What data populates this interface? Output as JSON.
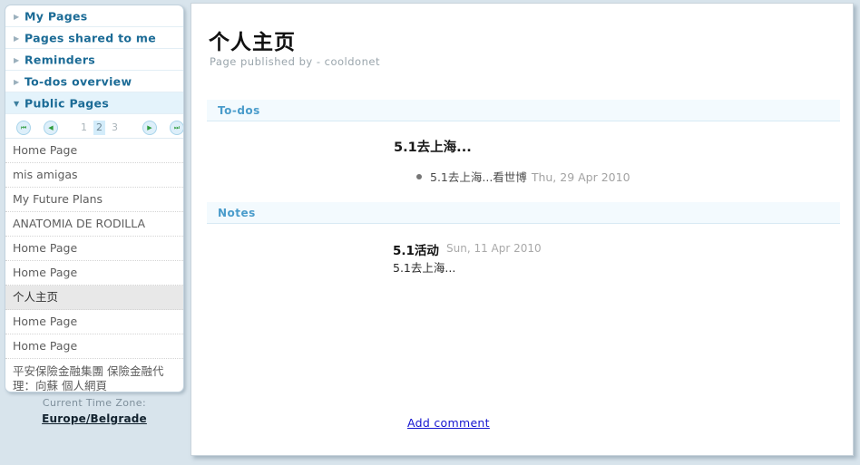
{
  "sidebar": {
    "nav": [
      {
        "label": "My Pages",
        "icon": "triangle-right-icon",
        "expanded": false
      },
      {
        "label": "Pages shared to me",
        "icon": "triangle-right-icon",
        "expanded": false
      },
      {
        "label": "Reminders",
        "icon": "triangle-right-icon",
        "expanded": false
      },
      {
        "label": "To-dos overview",
        "icon": "triangle-right-icon",
        "expanded": false
      },
      {
        "label": "Public Pages",
        "icon": "triangle-down-icon",
        "expanded": true
      }
    ],
    "pager": {
      "first_icon": "⏮",
      "prev_icon": "◀",
      "next_icon": "▶",
      "last_icon": "⏭",
      "pages": [
        "1",
        "2",
        "3"
      ],
      "current": "2"
    },
    "pages": [
      {
        "label": "Home Page",
        "selected": false
      },
      {
        "label": "mis amigas",
        "selected": false
      },
      {
        "label": "My Future Plans",
        "selected": false
      },
      {
        "label": "ANATOMIA DE RODILLA",
        "selected": false
      },
      {
        "label": "Home Page",
        "selected": false
      },
      {
        "label": "Home Page",
        "selected": false
      },
      {
        "label": "个人主页",
        "selected": true
      },
      {
        "label": "Home Page",
        "selected": false
      },
      {
        "label": "Home Page",
        "selected": false
      },
      {
        "label": "平安保險金融集團 保險金融代理：向蘇 個人網頁",
        "selected": false
      }
    ],
    "timezone": {
      "label": "Current Time Zone:",
      "value": "Europe/Belgrade"
    }
  },
  "main": {
    "title": "个人主页",
    "subtitle": "Page published by - cooldonet",
    "todos": {
      "header": "To-dos",
      "group_title": "5.1去上海...",
      "item_text": "5.1去上海...看世博",
      "item_date": "Thu, 29 Apr 2010"
    },
    "notes": {
      "header": "Notes",
      "note_title": "5.1活动",
      "note_date": "Sun, 11 Apr 2010",
      "note_body": "5.1去上海..."
    },
    "add_comment": "Add comment"
  },
  "colors": {
    "page_background": "#d8e4ec",
    "nav_text": "#1b6b96",
    "section_header_text": "#4a9ccb",
    "section_header_bg": "#f3fafe",
    "link": "#1414d0",
    "selected_row_bg": "#e8e8e8",
    "pager_arrow": "#2e9c3c"
  }
}
